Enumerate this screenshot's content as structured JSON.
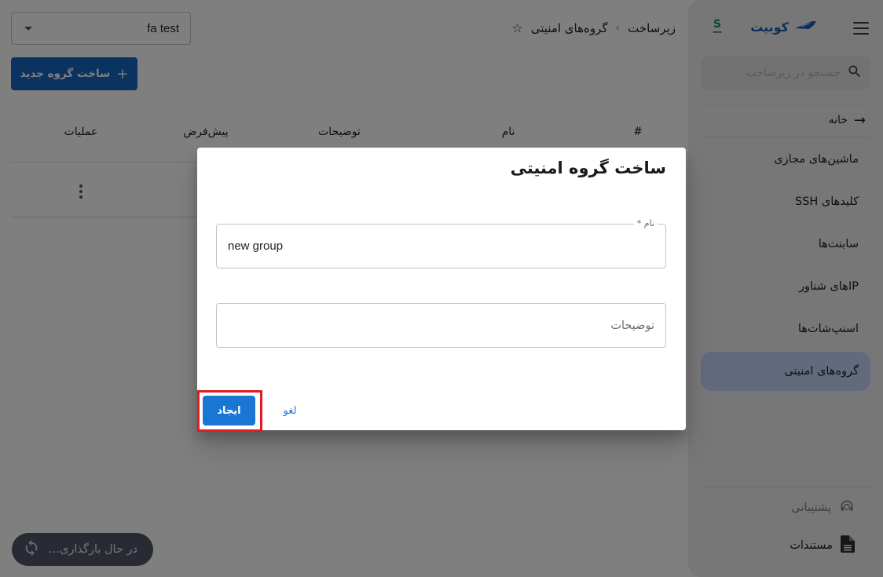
{
  "sidebar": {
    "brand_name": "کوبیت",
    "search_placeholder": "جستجو در زیرساخت",
    "home_label": "خانه",
    "items": [
      {
        "label": "ماشین‌های مجازی",
        "active": false
      },
      {
        "label": "کلیدهای SSH",
        "active": false
      },
      {
        "label": "سابنت‌ها",
        "active": false
      },
      {
        "label": "IPهای شناور",
        "active": false
      },
      {
        "label": "اسنپ‌شات‌ها",
        "active": false
      },
      {
        "label": "گروه‌های امنیتی",
        "active": true
      }
    ],
    "bottom": {
      "support_label": "پشتیبانی",
      "docs_label": "مستندات"
    },
    "icons": {
      "menu": "hamburger-icon",
      "brand": "ship-icon",
      "partner": "partner-logo",
      "search": "search-icon",
      "home": "arrow-right-icon",
      "support": "headset-icon",
      "docs": "document-icon"
    }
  },
  "header": {
    "breadcrumb": [
      "زیرساخت",
      "گروه‌های امنیتی"
    ],
    "breadcrumb_separator": "›",
    "favorite_icon": "star-outline-icon",
    "project_select": {
      "value": "fa test"
    }
  },
  "toolbar": {
    "create_label": "ساخت گروه جدید",
    "create_icon": "+"
  },
  "table": {
    "columns": [
      "#",
      "نام",
      "توضیحات",
      "پیش‌فرض",
      "عملیات"
    ],
    "rows": [
      {
        "num": "",
        "name": "",
        "description": "",
        "default": "✓",
        "actions_icon": "kebab-menu-icon"
      }
    ]
  },
  "loading": {
    "label": "در حال بارگذاری...",
    "icon": "refresh-icon"
  },
  "dialog": {
    "title": "ساخت گروه امنیتی",
    "name_field": {
      "label": "نام *",
      "value": "new group"
    },
    "description_field": {
      "placeholder": "توضیحات",
      "value": ""
    },
    "create_label": "ایجاد",
    "cancel_label": "لغو",
    "highlight_color": "#e11b22"
  },
  "colors": {
    "primary": "#1976d2",
    "brand": "#1d5fae",
    "active_item": "#c4d5fd"
  }
}
